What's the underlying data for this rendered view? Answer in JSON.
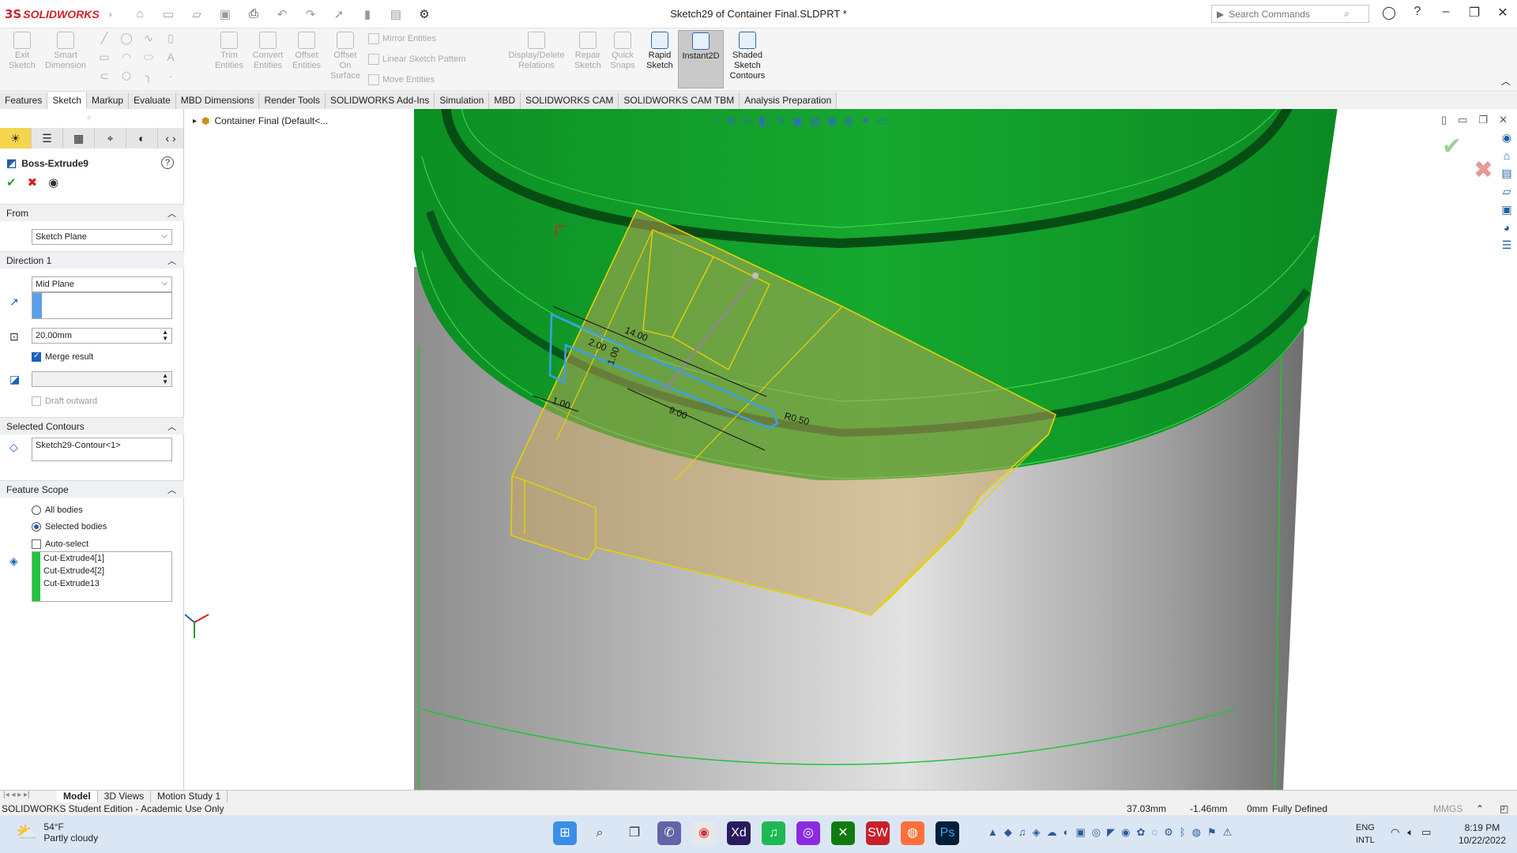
{
  "app": {
    "brand": "SOLIDWORKS",
    "ds": "3S",
    "doc_title": "Sketch29 of Container Final.SLDPRT *"
  },
  "search": {
    "placeholder": "Search Commands"
  },
  "commands": {
    "exit_sketch": "Exit Sketch",
    "smart_dimension": "Smart Dimension",
    "trim_entities": "Trim Entities",
    "convert_entities": "Convert Entities",
    "offset_entities": "Offset Entities",
    "offset_on_surface": "Offset On Surface",
    "mirror_entities": "Mirror Entities",
    "linear_sketch_pattern": "Linear Sketch Pattern",
    "move_entities": "Move Entities",
    "display_delete_relations": "Display/Delete Relations",
    "repair_sketch": "Repair Sketch",
    "quick_snaps": "Quick Snaps",
    "rapid_sketch": "Rapid Sketch",
    "instant2d": "Instant2D",
    "shaded_sketch_contours": "Shaded Sketch Contours"
  },
  "tabs": [
    "Features",
    "Sketch",
    "Markup",
    "Evaluate",
    "MBD Dimensions",
    "Render Tools",
    "SOLIDWORKS Add-Ins",
    "Simulation",
    "MBD",
    "SOLIDWORKS CAM",
    "SOLIDWORKS CAM TBM",
    "Analysis Preparation"
  ],
  "property_manager": {
    "title": "Boss-Extrude9",
    "from": {
      "header": "From",
      "value": "Sketch Plane"
    },
    "direction1": {
      "header": "Direction 1",
      "end_condition": "Mid Plane",
      "depth": "20.00mm",
      "merge_result": "Merge result",
      "draft_outward": "Draft outward"
    },
    "selected_contours": {
      "header": "Selected Contours",
      "value": "Sketch29-Contour<1>"
    },
    "feature_scope": {
      "header": "Feature Scope",
      "all_bodies": "All bodies",
      "selected_bodies": "Selected bodies",
      "auto_select": "Auto-select",
      "bodies": [
        "Cut-Extrude4[1]",
        "Cut-Extrude4[2]",
        "Cut-Extrude13"
      ]
    }
  },
  "tree_flyout": {
    "label": "Container Final  (Default<..."
  },
  "sketch_dims": {
    "d1": "14.00",
    "d2": "2.00",
    "d3": "1.00",
    "d4": "9.00",
    "d5": "R0.50",
    "d6": "1.00"
  },
  "bottom_tabs": [
    "Model",
    "3D Views",
    "Motion Study 1"
  ],
  "status": {
    "edition": "SOLIDWORKS Student Edition - Academic Use Only",
    "x": "37.03mm",
    "y": "-1.46mm",
    "z": "0mm",
    "state": "Fully Defined",
    "units": "MMGS"
  },
  "taskbar": {
    "temp": "54°F",
    "weather": "Partly cloudy",
    "lang1": "ENG",
    "lang2": "INTL",
    "time": "8:19 PM",
    "date": "10/22/2022"
  },
  "colors": {
    "green_face": "#0b8d22",
    "sketch_blue": "#3aa0e6",
    "preview_yellow": "#e6d100"
  }
}
